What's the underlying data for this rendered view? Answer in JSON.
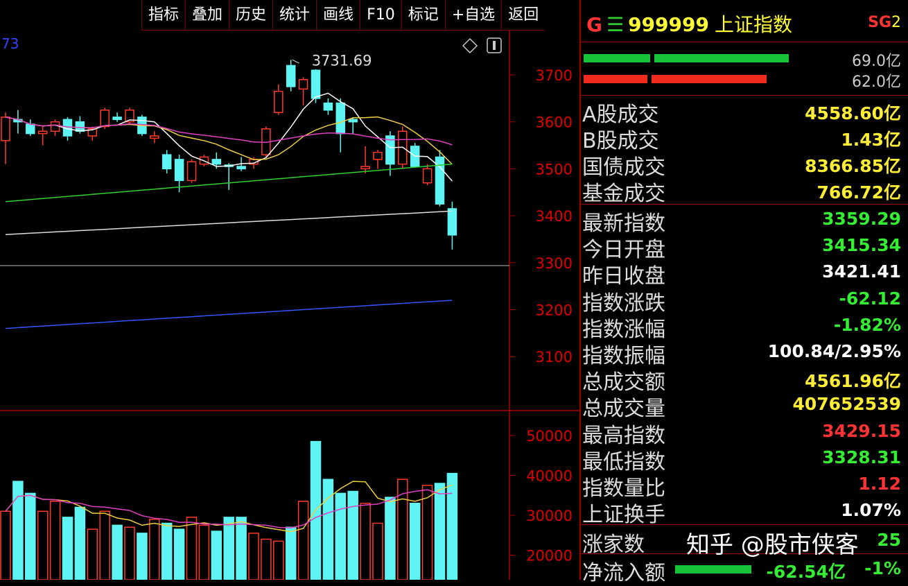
{
  "toolbar": [
    "指标",
    "叠加",
    "历史",
    "统计",
    "画线",
    "F10",
    "标记",
    "+自选",
    "返回"
  ],
  "chart_data": {
    "type": "candlestick",
    "corner_value": "73",
    "high_annotation": "3731.69",
    "price_ticks": [
      "3700",
      "3600",
      "3500",
      "3400",
      "3300",
      "3200",
      "3100"
    ],
    "volume_ticks": [
      "50000",
      "40000",
      "30000",
      "20000"
    ],
    "candles": [
      {
        "o": 3560,
        "h": 3620,
        "l": 3510,
        "c": 3610
      },
      {
        "o": 3605,
        "h": 3625,
        "l": 3575,
        "c": 3600
      },
      {
        "o": 3595,
        "h": 3605,
        "l": 3570,
        "c": 3575
      },
      {
        "o": 3575,
        "h": 3590,
        "l": 3550,
        "c": 3580
      },
      {
        "o": 3580,
        "h": 3605,
        "l": 3570,
        "c": 3600
      },
      {
        "o": 3605,
        "h": 3610,
        "l": 3560,
        "c": 3570
      },
      {
        "o": 3600,
        "h": 3612,
        "l": 3575,
        "c": 3580
      },
      {
        "o": 3570,
        "h": 3590,
        "l": 3560,
        "c": 3585
      },
      {
        "o": 3590,
        "h": 3630,
        "l": 3585,
        "c": 3625
      },
      {
        "o": 3610,
        "h": 3620,
        "l": 3600,
        "c": 3605
      },
      {
        "o": 3600,
        "h": 3630,
        "l": 3595,
        "c": 3625
      },
      {
        "o": 3610,
        "h": 3615,
        "l": 3570,
        "c": 3575
      },
      {
        "o": 3565,
        "h": 3580,
        "l": 3555,
        "c": 3570
      },
      {
        "o": 3530,
        "h": 3540,
        "l": 3490,
        "c": 3500
      },
      {
        "o": 3520,
        "h": 3530,
        "l": 3450,
        "c": 3475
      },
      {
        "o": 3475,
        "h": 3520,
        "l": 3470,
        "c": 3515
      },
      {
        "o": 3510,
        "h": 3530,
        "l": 3505,
        "c": 3525
      },
      {
        "o": 3520,
        "h": 3535,
        "l": 3500,
        "c": 3510
      },
      {
        "o": 3508,
        "h": 3512,
        "l": 3455,
        "c": 3505
      },
      {
        "o": 3505,
        "h": 3525,
        "l": 3495,
        "c": 3500
      },
      {
        "o": 3510,
        "h": 3525,
        "l": 3500,
        "c": 3520
      },
      {
        "o": 3530,
        "h": 3590,
        "l": 3525,
        "c": 3585
      },
      {
        "o": 3620,
        "h": 3680,
        "l": 3615,
        "c": 3665
      },
      {
        "o": 3720,
        "h": 3732,
        "l": 3665,
        "c": 3675
      },
      {
        "o": 3670,
        "h": 3695,
        "l": 3635,
        "c": 3690
      },
      {
        "o": 3710,
        "h": 3712,
        "l": 3640,
        "c": 3650
      },
      {
        "o": 3640,
        "h": 3650,
        "l": 3615,
        "c": 3625
      },
      {
        "o": 3640,
        "h": 3650,
        "l": 3535,
        "c": 3575
      },
      {
        "o": 3605,
        "h": 3610,
        "l": 3575,
        "c": 3600
      },
      {
        "o": 3500,
        "h": 3548,
        "l": 3490,
        "c": 3505
      },
      {
        "o": 3520,
        "h": 3540,
        "l": 3500,
        "c": 3535
      },
      {
        "o": 3570,
        "h": 3580,
        "l": 3485,
        "c": 3510
      },
      {
        "o": 3510,
        "h": 3590,
        "l": 3500,
        "c": 3580
      },
      {
        "o": 3548,
        "h": 3555,
        "l": 3505,
        "c": 3505
      },
      {
        "o": 3470,
        "h": 3510,
        "l": 3465,
        "c": 3500
      },
      {
        "o": 3525,
        "h": 3540,
        "l": 3420,
        "c": 3425
      },
      {
        "o": 3415,
        "h": 3430,
        "l": 3328,
        "c": 3359
      }
    ],
    "volumes": [
      31000,
      38500,
      35500,
      31000,
      33500,
      29500,
      32000,
      26500,
      31000,
      27500,
      27000,
      25500,
      29000,
      28000,
      26500,
      29500,
      27500,
      26000,
      29500,
      29500,
      25500,
      24000,
      23500,
      27000,
      33500,
      48500,
      39000,
      35500,
      36000,
      33000,
      28000,
      34500,
      39000,
      33000,
      37500,
      38000,
      40500
    ]
  },
  "header": {
    "g": "G",
    "eq": "☰",
    "code": "999999",
    "name": "上证指数",
    "sg_a": "SG",
    "sg_b": "2"
  },
  "flow_bars": [
    {
      "value": "69.0亿",
      "color": "#16c43a"
    },
    {
      "value": "62.0亿",
      "color": "#ee2b1e"
    }
  ],
  "turnover": [
    {
      "label": "A股成交",
      "value": "4558.60亿",
      "color": "yel"
    },
    {
      "label": "B股成交",
      "value": "1.43亿",
      "color": "yel"
    },
    {
      "label": "国债成交",
      "value": "8366.85亿",
      "color": "yel"
    },
    {
      "label": "基金成交",
      "value": "766.72亿",
      "color": "yel"
    }
  ],
  "stats": [
    {
      "label": "最新指数",
      "value": "3359.29",
      "color": "grn"
    },
    {
      "label": "今日开盘",
      "value": "3415.34",
      "color": "grn"
    },
    {
      "label": "昨日收盘",
      "value": "3421.41",
      "color": "wht"
    },
    {
      "label": "指数涨跌",
      "value": "-62.12",
      "color": "grn"
    },
    {
      "label": "指数涨幅",
      "value": "-1.82%",
      "color": "grn"
    },
    {
      "label": "指数振幅",
      "value": "100.84/2.95%",
      "color": "wht"
    },
    {
      "label": "总成交额",
      "value": "4561.96亿",
      "color": "yel"
    },
    {
      "label": "总成交量",
      "value": "407652539",
      "color": "yel"
    },
    {
      "label": "最高指数",
      "value": "3429.15",
      "color": "red"
    },
    {
      "label": "最低指数",
      "value": "3328.31",
      "color": "grn"
    },
    {
      "label": "指数量比",
      "value": "1.12",
      "color": "red"
    },
    {
      "label": "上证换手",
      "value": "1.07%",
      "color": "wht"
    }
  ],
  "bottom": {
    "up_label": "涨家数",
    "up_value": "25",
    "net_label": "净流入额",
    "net_value": "-62.54亿",
    "net_pct": "-1%"
  },
  "watermark": "知乎 @股市侠客"
}
